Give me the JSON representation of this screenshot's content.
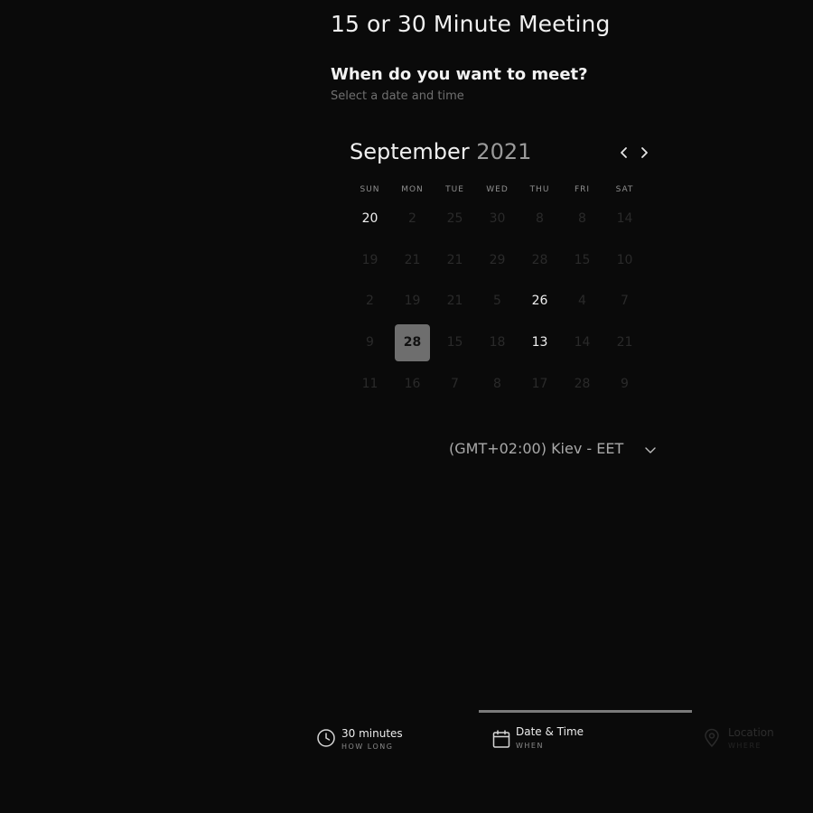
{
  "header": {
    "title": "15 or 30 Minute Meeting",
    "question": "When do you want to meet?",
    "subtitle": "Select a date and time"
  },
  "calendar": {
    "month": "September",
    "year": "2021",
    "weekdays": [
      "SUN",
      "MON",
      "TUE",
      "WED",
      "THU",
      "FRI",
      "SAT"
    ],
    "weeks": [
      [
        {
          "label": "20",
          "available": true
        },
        {
          "label": "2",
          "available": false
        },
        {
          "label": "25",
          "available": false
        },
        {
          "label": "30",
          "available": false
        },
        {
          "label": "8",
          "available": false
        },
        {
          "label": "8",
          "available": false
        },
        {
          "label": "14",
          "available": false
        }
      ],
      [
        {
          "label": "19",
          "available": false
        },
        {
          "label": "21",
          "available": false
        },
        {
          "label": "21",
          "available": false
        },
        {
          "label": "29",
          "available": false
        },
        {
          "label": "28",
          "available": false
        },
        {
          "label": "15",
          "available": false
        },
        {
          "label": "10",
          "available": false
        }
      ],
      [
        {
          "label": "2",
          "available": false
        },
        {
          "label": "19",
          "available": false
        },
        {
          "label": "21",
          "available": false
        },
        {
          "label": "5",
          "available": false
        },
        {
          "label": "26",
          "available": true
        },
        {
          "label": "4",
          "available": false
        },
        {
          "label": "7",
          "available": false
        }
      ],
      [
        {
          "label": "9",
          "available": false
        },
        {
          "label": "28",
          "available": true,
          "selected": true
        },
        {
          "label": "15",
          "available": false
        },
        {
          "label": "18",
          "available": false
        },
        {
          "label": "13",
          "available": true
        },
        {
          "label": "14",
          "available": false
        },
        {
          "label": "21",
          "available": false
        }
      ],
      [
        {
          "label": "11",
          "available": false
        },
        {
          "label": "16",
          "available": false
        },
        {
          "label": "7",
          "available": false
        },
        {
          "label": "8",
          "available": false
        },
        {
          "label": "17",
          "available": false
        },
        {
          "label": "28",
          "available": false
        },
        {
          "label": "9",
          "available": false
        }
      ]
    ]
  },
  "timezone": {
    "label": "(GMT+02:00) Kiev - EET"
  },
  "steps": [
    {
      "label": "30 minutes",
      "sub": "HOW LONG",
      "icon": "clock-icon"
    },
    {
      "label": "Date & Time",
      "sub": "WHEN",
      "icon": "calendar-icon"
    },
    {
      "label": "Location",
      "sub": "WHERE",
      "icon": "location-pin-icon"
    }
  ],
  "colors": {
    "background": "#0a0a0a",
    "selected_day_bg": "#6e6e6e",
    "active_step_bar": "#7a7a7a"
  }
}
